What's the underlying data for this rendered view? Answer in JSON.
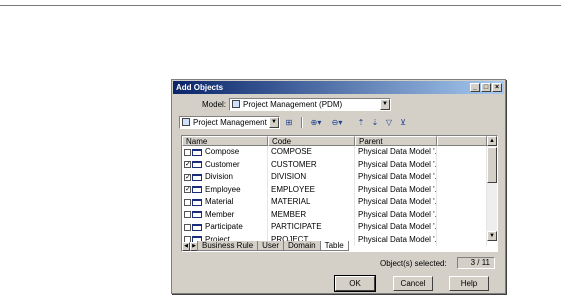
{
  "dialog": {
    "title": "Add Objects",
    "model_label": "Model:",
    "model_value": "Project Management (PDM)",
    "package_value": "Project Management (PDM"
  },
  "toolbar": {
    "icons": [
      "package-icon",
      "filter-icon",
      "select-icon",
      "deselect-icon",
      "include-icon",
      "exclude-icon",
      "find-icon",
      "clear-filter-icon"
    ]
  },
  "grid": {
    "columns": [
      "Name",
      "Code",
      "Parent"
    ],
    "rows": [
      {
        "checked": false,
        "name": "Compose",
        "code": "COMPOSE",
        "parent": "Physical Data Model '..."
      },
      {
        "checked": true,
        "name": "Customer",
        "code": "CUSTOMER",
        "parent": "Physical Data Model '..."
      },
      {
        "checked": true,
        "name": "Division",
        "code": "DIVISION",
        "parent": "Physical Data Model '..."
      },
      {
        "checked": true,
        "name": "Employee",
        "code": "EMPLOYEE",
        "parent": "Physical Data Model '..."
      },
      {
        "checked": false,
        "name": "Material",
        "code": "MATERIAL",
        "parent": "Physical Data Model '..."
      },
      {
        "checked": false,
        "name": "Member",
        "code": "MEMBER",
        "parent": "Physical Data Model '..."
      },
      {
        "checked": false,
        "name": "Participate",
        "code": "PARTICIPATE",
        "parent": "Physical Data Model '..."
      },
      {
        "checked": false,
        "name": "Project",
        "code": "PROJECT",
        "parent": "Physical Data Model '..."
      }
    ]
  },
  "tabs": [
    "Business Rule",
    "User",
    "Domain",
    "Table"
  ],
  "active_tab": "Table",
  "status": {
    "label": "Object(s) selected:",
    "count": "3 / 11"
  },
  "buttons": {
    "ok": "OK",
    "cancel": "Cancel",
    "help": "Help"
  }
}
